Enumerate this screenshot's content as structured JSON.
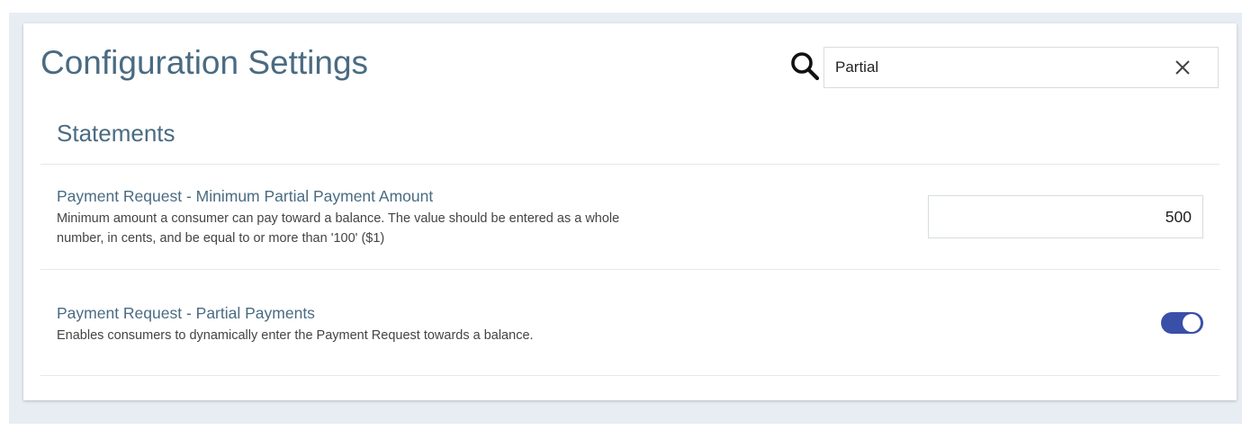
{
  "header": {
    "title": "Configuration Settings"
  },
  "search": {
    "value": "Partial",
    "icon": "search-icon",
    "clear_icon": "close-icon"
  },
  "section": {
    "title": "Statements"
  },
  "settings": [
    {
      "label": "Payment Request - Minimum Partial Payment Amount",
      "description": "Minimum amount a consumer can pay toward a balance. The value should be entered as a whole number, in cents, and be equal to or more than '100' ($1)",
      "control": "text-input",
      "value": "500"
    },
    {
      "label": "Payment Request - Partial Payments",
      "description": "Enables consumers to dynamically enter the Payment Request towards a balance.",
      "control": "toggle",
      "enabled": true
    }
  ],
  "colors": {
    "accent": "#3a4fa8",
    "heading": "#4a6b82",
    "background": "#e7edf3"
  }
}
